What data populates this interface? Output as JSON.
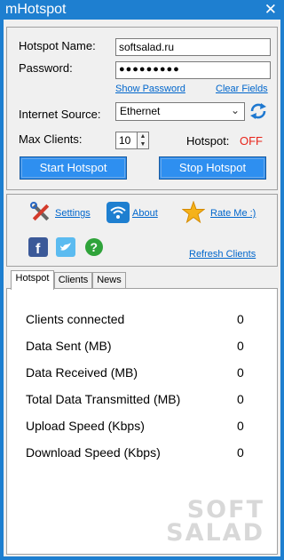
{
  "window": {
    "title": "mHotspot",
    "close_glyph": "✕"
  },
  "form": {
    "hotspot_name_label": "Hotspot Name:",
    "hotspot_name_value": "softsalad.ru",
    "password_label": "Password:",
    "password_value": "●●●●●●●●●",
    "show_password_link": "Show Password",
    "clear_fields_link": "Clear Fields",
    "internet_source_label": "Internet Source:",
    "internet_source_value": "Ethernet",
    "max_clients_label": "Max Clients:",
    "max_clients_value": "10",
    "hotspot_status_label": "Hotspot:",
    "hotspot_status_value": "OFF",
    "start_button": "Start Hotspot",
    "stop_button": "Stop Hotspot"
  },
  "links": {
    "settings": "Settings",
    "about": "About",
    "rate_me": "Rate Me :)",
    "refresh_clients": "Refresh Clients"
  },
  "icons": {
    "refresh": "refresh-icon",
    "settings": "tools-icon",
    "about": "wifi-icon",
    "rate": "star-icon",
    "facebook": "facebook-icon",
    "twitter": "twitter-icon",
    "help": "help-icon"
  },
  "tabs": [
    "Hotspot",
    "Clients",
    "News"
  ],
  "stats": [
    {
      "label": "Clients connected",
      "value": "0"
    },
    {
      "label": "Data Sent (MB)",
      "value": "0"
    },
    {
      "label": "Data Received (MB)",
      "value": "0"
    },
    {
      "label": "Total Data Transmitted (MB)",
      "value": "0"
    },
    {
      "label": "Upload Speed (Kbps)",
      "value": "0"
    },
    {
      "label": "Download Speed (Kbps)",
      "value": "0"
    }
  ],
  "watermark": {
    "line1": "SOFT",
    "line2": "SALAD"
  },
  "colors": {
    "titlebar": "#1e7fd0",
    "button": "#2e8ff0",
    "status_off": "#e8241a",
    "link": "#0066cc"
  }
}
